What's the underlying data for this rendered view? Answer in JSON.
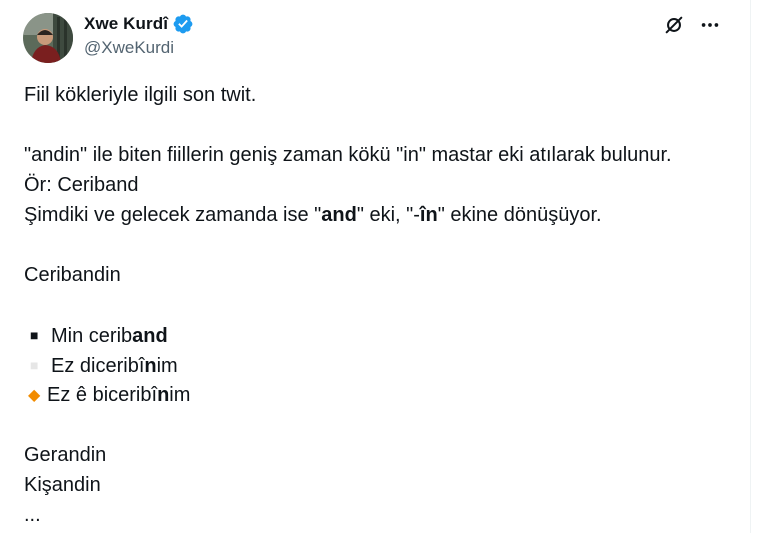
{
  "author": {
    "display_name": "Xwe Kurdî",
    "handle": "@XweKurdi",
    "verified": true
  },
  "actions": {
    "grok_icon": "slashed-circle-icon",
    "more_icon": "more-horizontal-icon"
  },
  "tweet": {
    "line1": "Fiil kökleriyle ilgili son twit.",
    "line2": "\"andin\" ile biten fiillerin geniş zaman kökü \"in\" mastar eki atılarak bulunur.",
    "line3": "Ör: Ceriband",
    "line4_pre": "Şimdiki ve gelecek zamanda ise \"",
    "line4_bold1": "and",
    "line4_mid": "\" eki, \"-",
    "line4_bold2": "în",
    "line4_post": "\" ekine dönüşüyor.",
    "example_word": "Ceribandin",
    "list": [
      {
        "marker": "■",
        "pre": "Min cerib",
        "bold": "and",
        "post": ""
      },
      {
        "marker": "■",
        "pre": "Ez diceribî",
        "bold": "n",
        "post": "im"
      },
      {
        "marker": "◆",
        "pre": "Ez ê biceribî",
        "bold": "n",
        "post": "im"
      }
    ],
    "more1": "Gerandin",
    "more2": "Kişandin",
    "ellipsis": "..."
  },
  "colors": {
    "text": "#0f1419",
    "secondary": "#536471",
    "verified_blue": "#1d9bf0",
    "diamond_orange": "#f28c00"
  }
}
